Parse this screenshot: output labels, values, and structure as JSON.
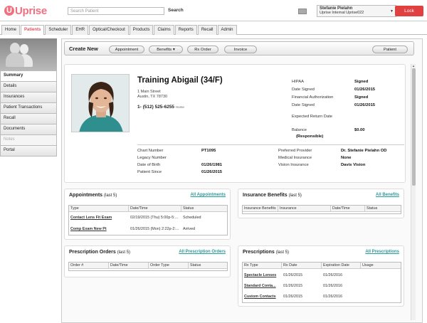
{
  "app": {
    "name": "Uprise"
  },
  "search": {
    "placeholder": "Search Patient",
    "button": "Search"
  },
  "user": {
    "name": "Stefanie Pielahn",
    "org": "Uprise Internal Uprise022"
  },
  "lock": "Lock",
  "tabs": [
    "Home",
    "Patients",
    "Scheduler",
    "EHR",
    "Optical/Checkout",
    "Products",
    "Claims",
    "Reports",
    "Recall",
    "Admin"
  ],
  "active_tab": "Patients",
  "sidebar": [
    "Summary",
    "Details",
    "Insurances",
    "Patient Transactions",
    "Recall",
    "Documents",
    "Notes",
    "Portal"
  ],
  "create": {
    "label": "Create New",
    "appointment": "Appointment",
    "benefits": "Benefits",
    "rx_order": "Rx Order",
    "invoice": "Invoice",
    "patient": "Patient"
  },
  "patient": {
    "name": "Training Abigail (34/F)",
    "address1": "1 Main Street",
    "address2": "Austin, TX 78730",
    "phone_prefix": "1-",
    "phone": "(512) 525-6255",
    "phone_type": "Home",
    "hipaa_label": "HIPAA",
    "hipaa": "Signed",
    "date_signed_label": "Date Signed",
    "date_signed": "01/26/2015",
    "fin_auth_label": "Financial Authorization",
    "fin_auth": "Signed",
    "date_signed2_label": "Date Signed",
    "date_signed2": "01/26/2015",
    "expected_return_label": "Expected Return Date",
    "balance_label": "Balance",
    "balance": "$0.00",
    "balance_note": "(Responsible)",
    "chart_label": "Chart Number",
    "chart": "PT1095",
    "legacy_label": "Legacy Number",
    "dob_label": "Date of Birth",
    "dob": "01/26/1981",
    "since_label": "Patient Since",
    "since": "01/26/2015",
    "provider_label": "Preferred Provider",
    "provider": "Dr. Stefanie Pielahn OD",
    "medical_label": "Medical Insurance",
    "medical": "None",
    "vision_label": "Vision Insurance",
    "vision": "Davis Vision"
  },
  "appointments": {
    "title": "Appointments",
    "suffix": "(last 5)",
    "link": "All Appointments",
    "columns": [
      "Type",
      "Date/Time",
      "Status"
    ],
    "rows": [
      [
        "Contact Lens Fit Exam",
        "02/19/2015 (Thu) 5:00p-5:...",
        "Scheduled"
      ],
      [
        "Comp Exam New Pt",
        "01/26/2015 (Mon) 2:22p-2:...",
        "Arrived"
      ]
    ]
  },
  "insurance": {
    "title": "Insurance Benefits",
    "suffix": "(last 5)",
    "link": "All Benefits",
    "columns": [
      "Insurance Benefits",
      "Insurance",
      "Date/Time",
      "Status"
    ]
  },
  "orders": {
    "title": "Prescription Orders",
    "suffix": "(last 5)",
    "link": "All Prescription Orders",
    "columns": [
      "Order #",
      "Date/Time",
      "Order Type",
      "Status"
    ]
  },
  "prescriptions": {
    "title": "Prescriptions",
    "suffix": "(last 5)",
    "link": "All Prescriptions",
    "columns": [
      "Rx Type",
      "Rx Date",
      "Expiration Date",
      "Usage"
    ],
    "rows": [
      [
        "Spectacle Lenses",
        "01/26/2015",
        "01/26/2016"
      ],
      [
        "Standard Conta...",
        "01/26/2015",
        "01/26/2016"
      ],
      [
        "Custom Contacts",
        "01/26/2015",
        "01/26/2016"
      ]
    ]
  },
  "colors": {
    "brand": "#f07080",
    "link": "#2a9a9a",
    "lock": "#e04040"
  }
}
